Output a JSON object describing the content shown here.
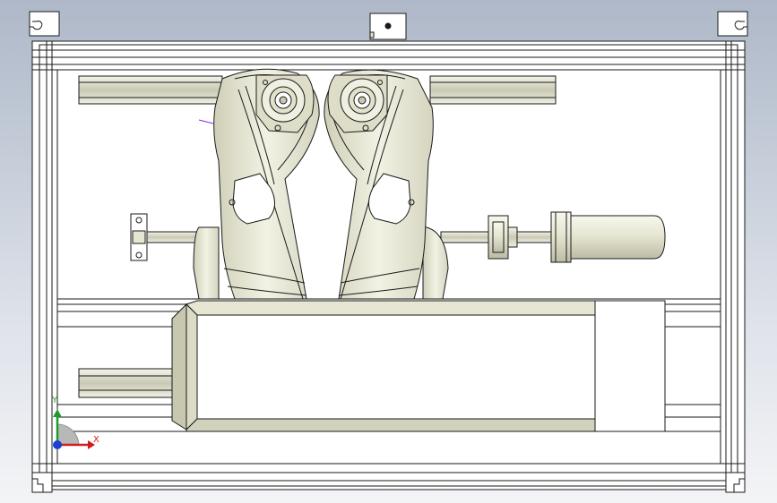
{
  "viewport": {
    "background_top": "#aeb8c8",
    "background_bottom": "#f3f4f6"
  },
  "triad": {
    "x_label": "X",
    "y_label": "Y",
    "x_color": "#d21c1c",
    "y_color": "#1e9a2e",
    "z_color": "#1a3fd6"
  },
  "model": {
    "frame_color": "#ffffff",
    "part_color": "#e6e6d2",
    "edge_color": "#1a1a1a"
  }
}
